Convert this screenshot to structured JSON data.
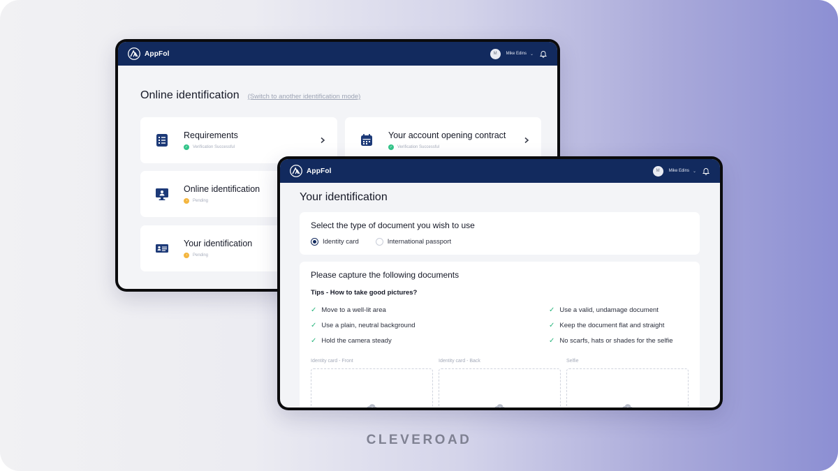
{
  "app": {
    "name": "AppFol",
    "user_initial": "M",
    "user_name": "Mike Edins"
  },
  "back_screen": {
    "title": "Online identification",
    "switch_link": "(Switch to another identification mode)",
    "tiles": [
      {
        "title": "Requirements",
        "status": "Verification Successful",
        "state": "success",
        "icon": "checklist-icon"
      },
      {
        "title": "Your account opening contract",
        "status": "Verification Successful",
        "state": "success",
        "icon": "calendar-icon"
      },
      {
        "title": "Online identification",
        "status": "Pending",
        "state": "pending",
        "icon": "monitor-user-icon"
      },
      {
        "title": "Your identification",
        "status": "Pending",
        "state": "pending",
        "icon": "id-card-icon"
      }
    ]
  },
  "front_screen": {
    "title": "Your identification",
    "doc_type": {
      "title": "Select the type of document you wish to use",
      "options": [
        "Identity card",
        "International passport"
      ],
      "selected": "Identity card"
    },
    "capture": {
      "title": "Please capture the following documents",
      "tips_title": "Tips - How to take good pictures?",
      "tips_left": [
        "Move to a well-lit area",
        "Use a plain, neutral background",
        "Hold the camera steady"
      ],
      "tips_right": [
        "Use a valid, undamage document",
        "Keep the document flat and straight",
        "No scarfs, hats or shades for the selfie"
      ],
      "uploads": [
        "Identity card - Front",
        "Identity card - Back",
        "Selfie"
      ]
    }
  },
  "brand": "CLEVEROAD",
  "colors": {
    "navbar": "#122a5e",
    "success": "#33c489",
    "pending": "#f4b63f",
    "icon": "#1d3a78"
  }
}
